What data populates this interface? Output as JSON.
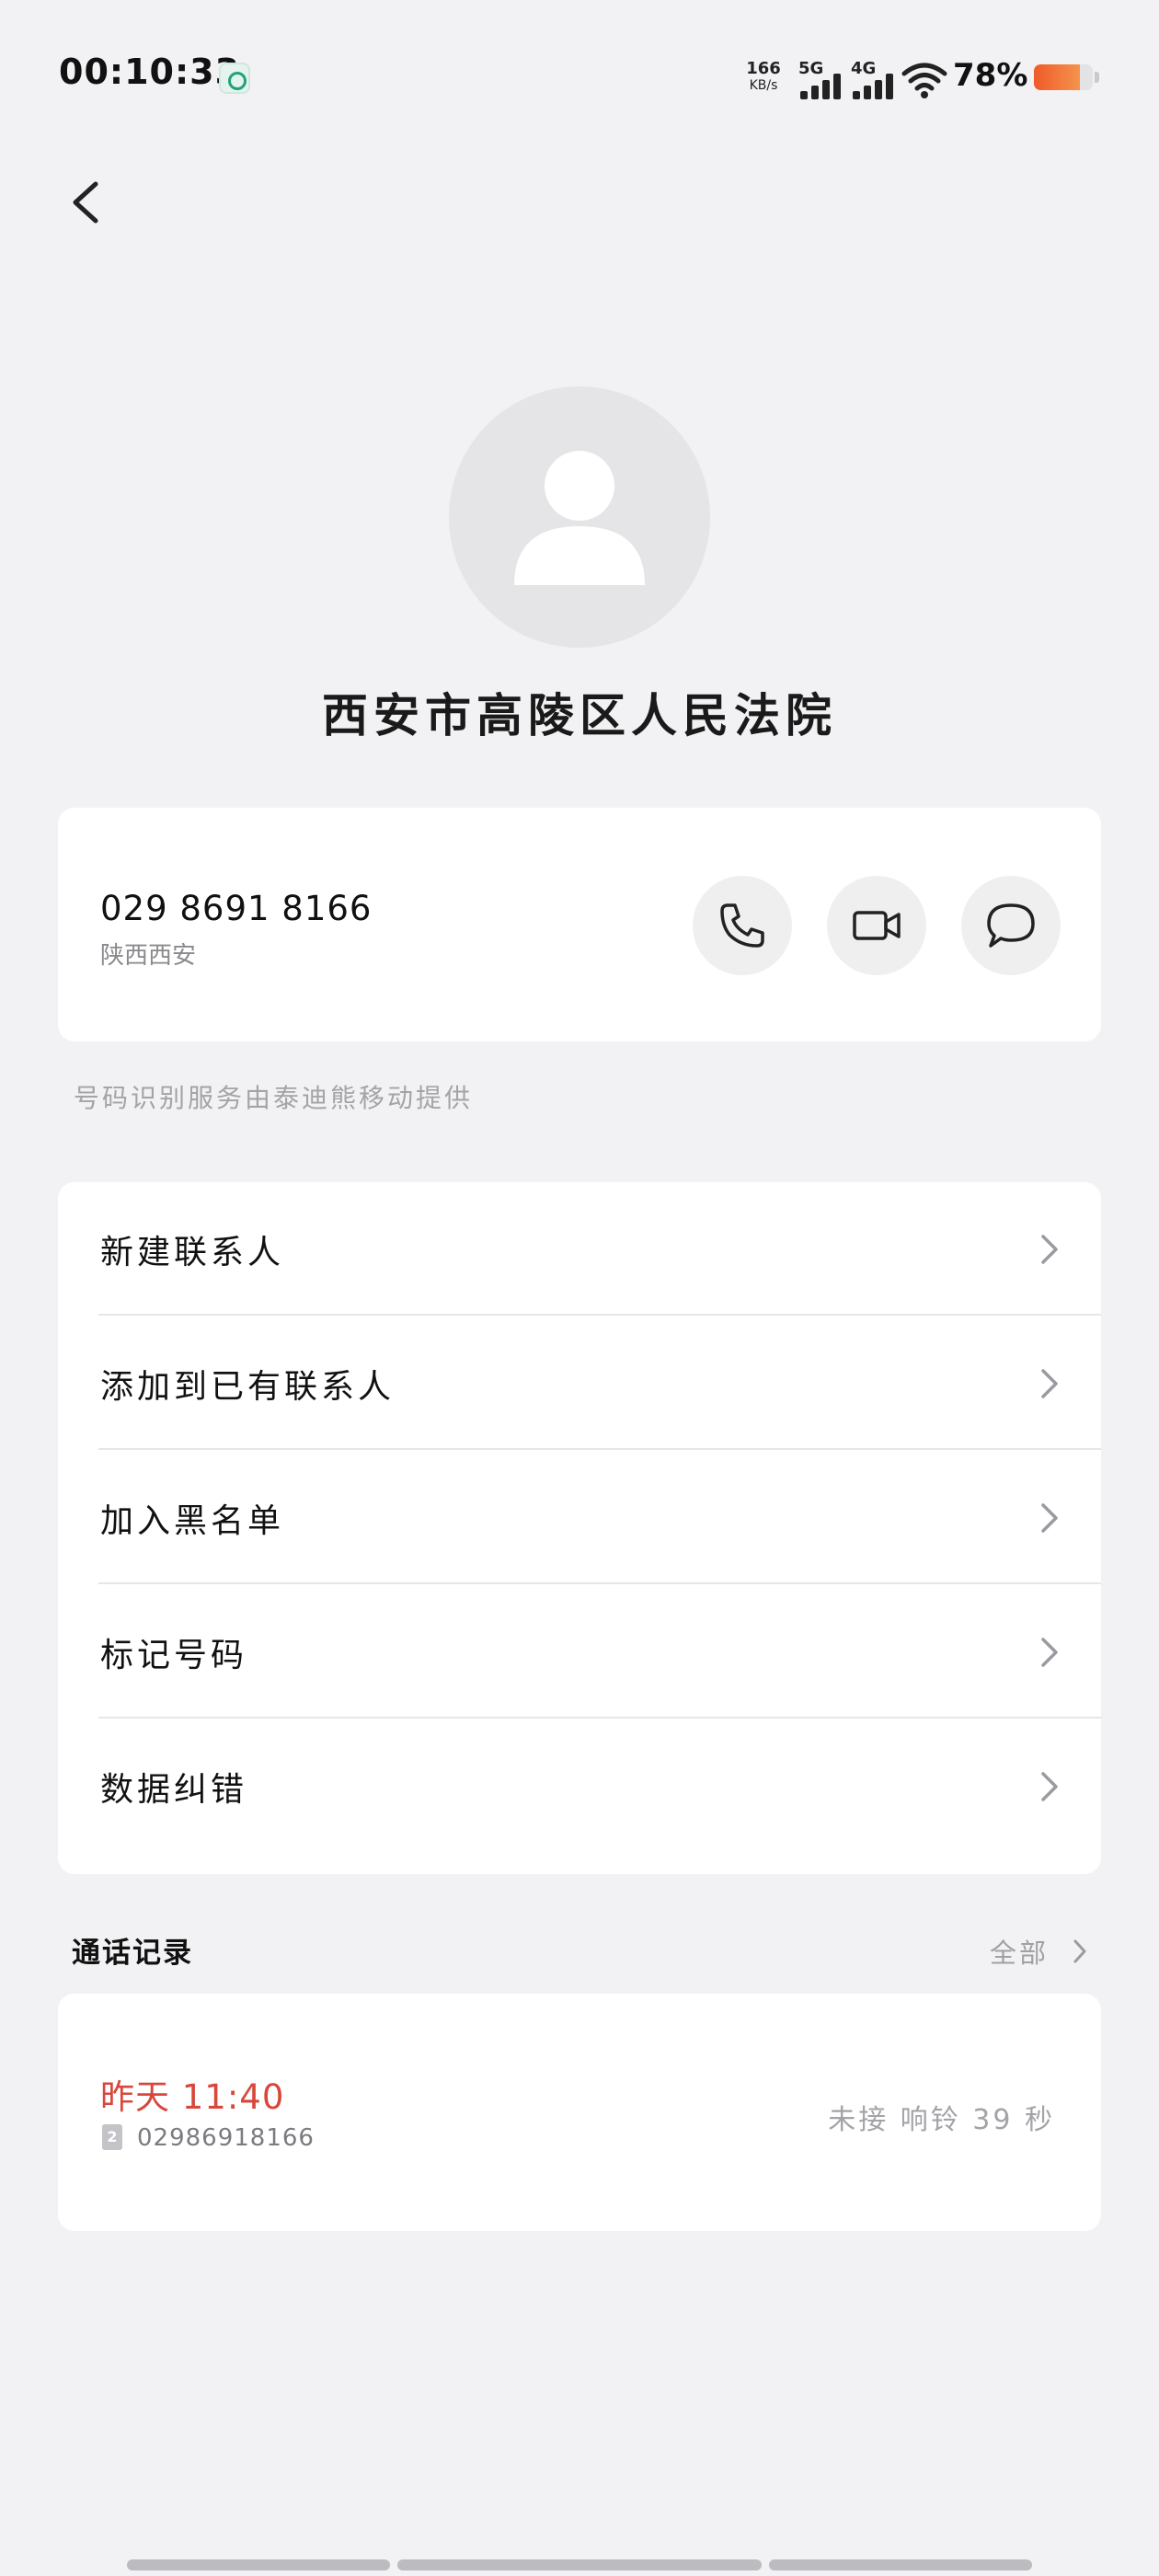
{
  "status_bar": {
    "time": "00:10:33",
    "net_speed_value": "166",
    "net_speed_unit": "KB/s",
    "signal_1_label": "5G",
    "signal_2_label": "4G",
    "battery_percent": "78%",
    "battery_level": 0.78
  },
  "contact": {
    "name": "西安市高陵区人民法院",
    "number": "029 8691 8166",
    "location": "陕西西安"
  },
  "service_note": "号码识别服务由泰迪熊移动提供",
  "actions": [
    {
      "label": "新建联系人"
    },
    {
      "label": "添加到已有联系人"
    },
    {
      "label": "加入黑名单"
    },
    {
      "label": "标记号码"
    },
    {
      "label": "数据纠错"
    }
  ],
  "call_log": {
    "title": "通话记录",
    "all_label": "全部",
    "entries": [
      {
        "time": "昨天 11:40",
        "sim": "2",
        "number": "02986918166",
        "status": "未接 响铃 39 秒"
      }
    ]
  },
  "colors": {
    "background": "#f2f2f4",
    "missed_call": "#d9473c",
    "battery": "#f05a2a"
  }
}
